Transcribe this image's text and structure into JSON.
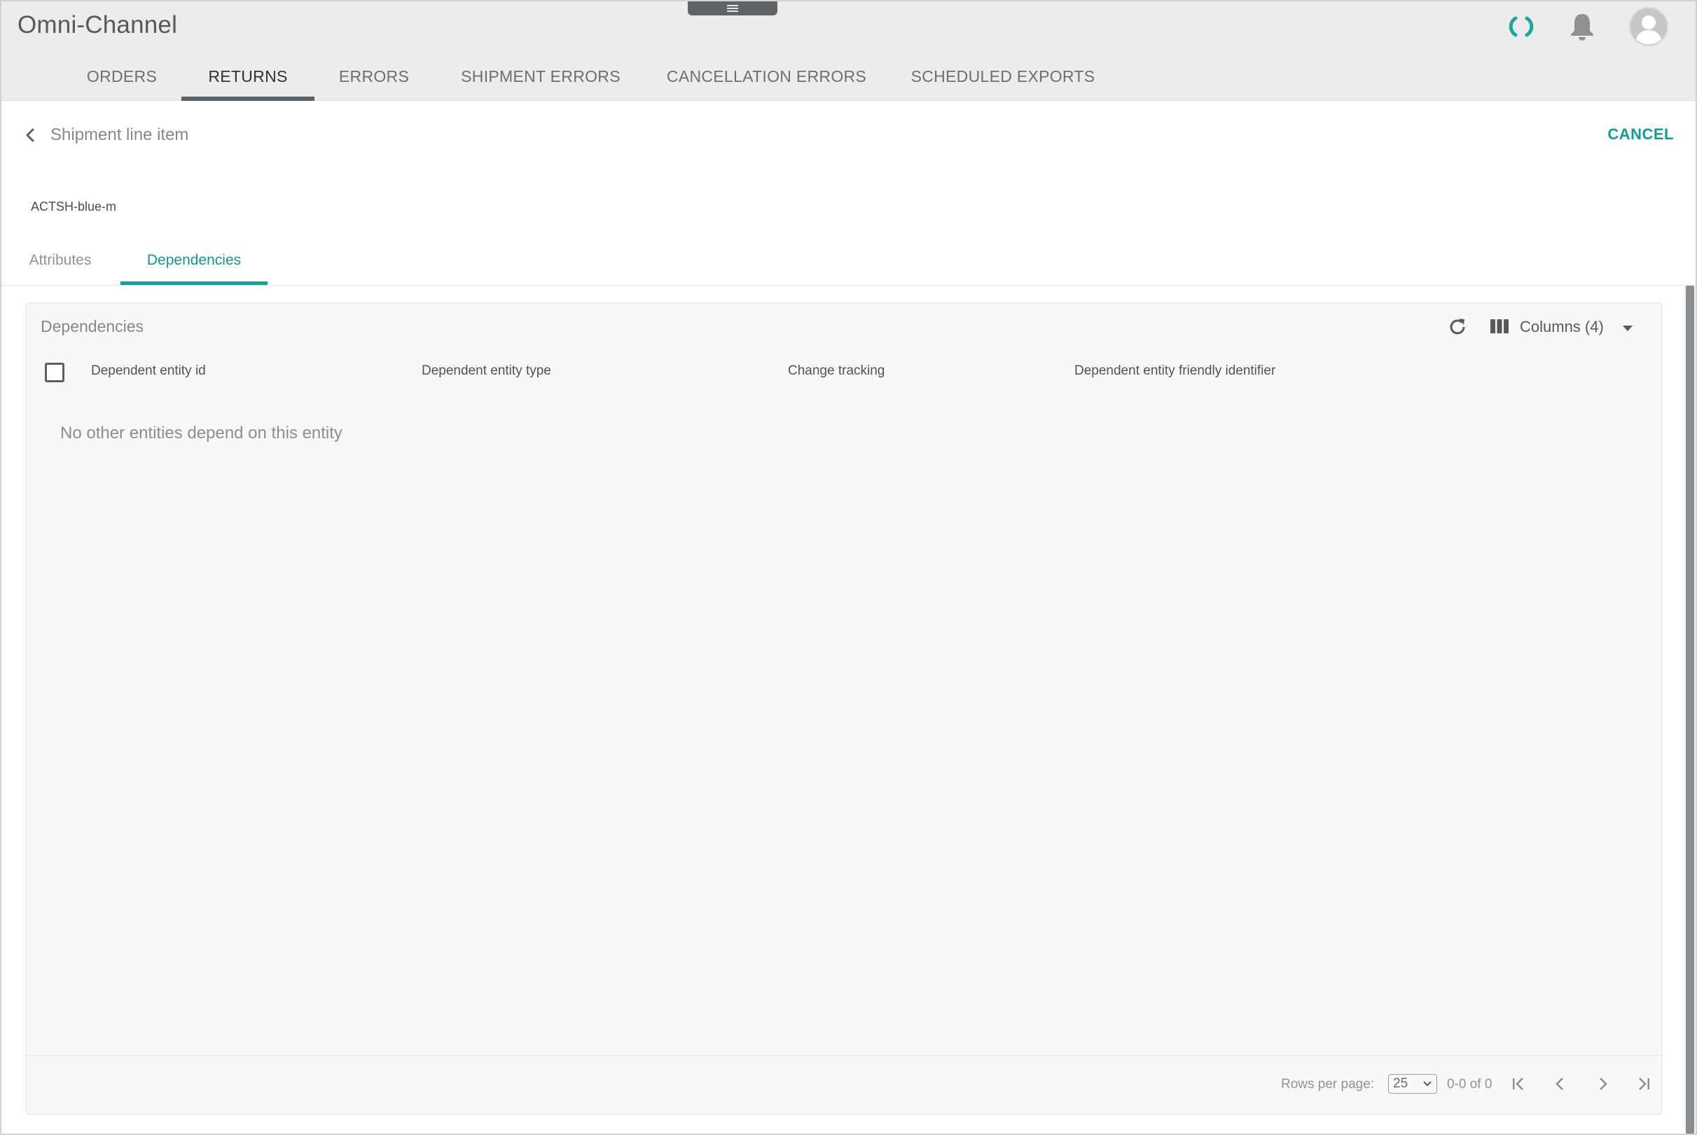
{
  "app": {
    "title": "Omni-Channel"
  },
  "main_tabs": [
    {
      "label": "ORDERS"
    },
    {
      "label": "RETURNS"
    },
    {
      "label": "ERRORS"
    },
    {
      "label": "SHIPMENT ERRORS"
    },
    {
      "label": "CANCELLATION ERRORS"
    },
    {
      "label": "SCHEDULED EXPORTS"
    }
  ],
  "active_main_tab": "RETURNS",
  "detail": {
    "title": "Shipment line item",
    "cancel_label": "CANCEL",
    "entity_identifier": "ACTSH-blue-m"
  },
  "sub_tabs": [
    {
      "label": "Attributes"
    },
    {
      "label": "Dependencies"
    }
  ],
  "active_sub_tab": "Dependencies",
  "panel": {
    "title": "Dependencies",
    "columns_label": "Columns (4)",
    "headers": [
      "Dependent entity id",
      "Dependent entity type",
      "Change tracking",
      "Dependent entity friendly identifier"
    ],
    "empty_message": "No other entities depend on this entity"
  },
  "pagination": {
    "rows_per_page_label": "Rows per page:",
    "rows_per_page_value": "25",
    "range_label": "0-0 of 0"
  },
  "colors": {
    "accent": "#13968d",
    "header_bg": "#ececec",
    "panel_bg": "#f8f8f8"
  },
  "icons": [
    "menu-icon",
    "loading-icon",
    "bell-icon",
    "user-avatar-icon",
    "back-arrow-icon",
    "refresh-icon",
    "columns-icon",
    "caret-down-icon",
    "first-page-icon",
    "previous-page-icon",
    "next-page-icon",
    "last-page-icon"
  ]
}
